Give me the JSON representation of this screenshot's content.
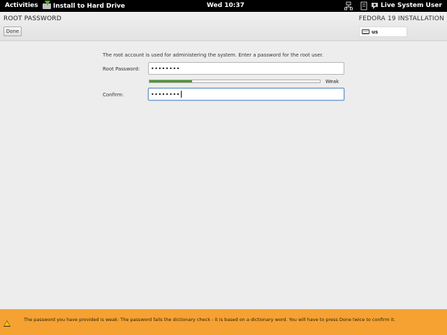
{
  "topbar": {
    "activities_label": "Activities",
    "app_menu_label": "Install to Hard Drive",
    "clock": "Wed 10:37",
    "user_label": "Live System User"
  },
  "header": {
    "page_title": "ROOT PASSWORD",
    "done_label": "Done",
    "install_title": "FEDORA 19 INSTALLATION",
    "keyboard_layout": "us"
  },
  "form": {
    "intro": "The root account is used for administering the system.  Enter a password for the root user.",
    "root_password_label": "Root Password:",
    "root_password_value": "••••••••",
    "strength_fraction": 0.25,
    "strength_label": "Weak",
    "confirm_label": "Confirm:",
    "confirm_value": "••••••••"
  },
  "warning": {
    "text": "The password you have provided is weak: The password fails the dictionary check - it is based on a dictionary word. You will have to press Done twice to confirm it."
  },
  "colors": {
    "topbar": "#000000",
    "warning_bg": "#f5a233",
    "strength_fill": "#4a9a2c",
    "focus_border": "#6f98c8"
  }
}
